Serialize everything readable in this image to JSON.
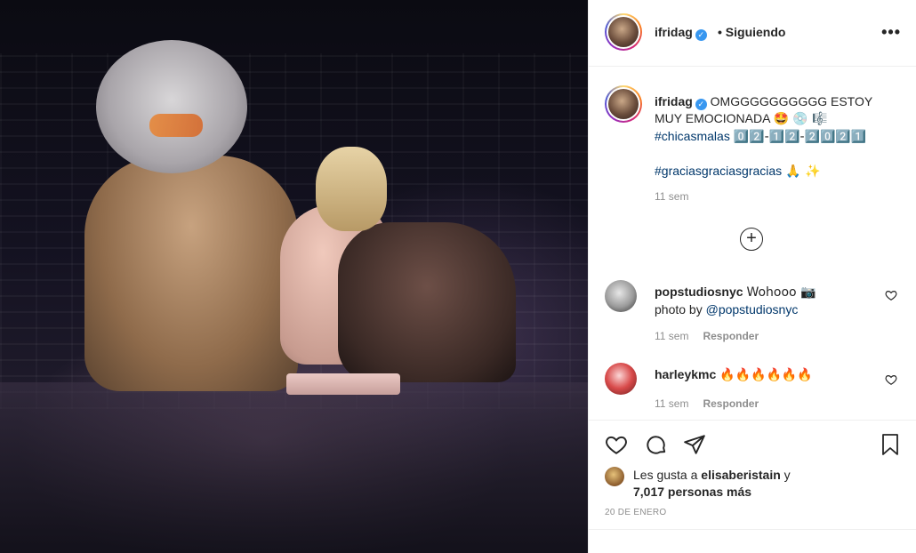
{
  "post": {
    "author": "ifridag",
    "follow_status": "• Siguiendo",
    "more": "•••"
  },
  "caption": {
    "author": "ifridag",
    "line1": "OMGGGGGGGGGG ESTOY",
    "line2": "MUY EMOCIONADA",
    "line2_emoji": "🤩 💿 🎼",
    "hashtag1": "#chicasmalas",
    "date_code": "0️⃣2️⃣-1️⃣2️⃣-2️⃣0️⃣2️⃣1️⃣",
    "hashtag2": "#graciasgraciasgracias",
    "hashtag2_emoji": "🙏 ✨",
    "time": "11 sem"
  },
  "comments": [
    {
      "author": "popstudiosnyc",
      "text": "Wohooo 📷",
      "text_line2_prefix": "photo by ",
      "mention": "@popstudiosnyc",
      "time": "11 sem",
      "reply": "Responder"
    },
    {
      "author": "harleykmc",
      "text": "🔥🔥🔥🔥🔥🔥",
      "time": "11 sem",
      "reply": "Responder"
    }
  ],
  "likes": {
    "prefix": "Les gusta a",
    "user": "elisaberistain",
    "conj": "y",
    "count": "7,017 personas más"
  },
  "date": "20 DE ENERO"
}
